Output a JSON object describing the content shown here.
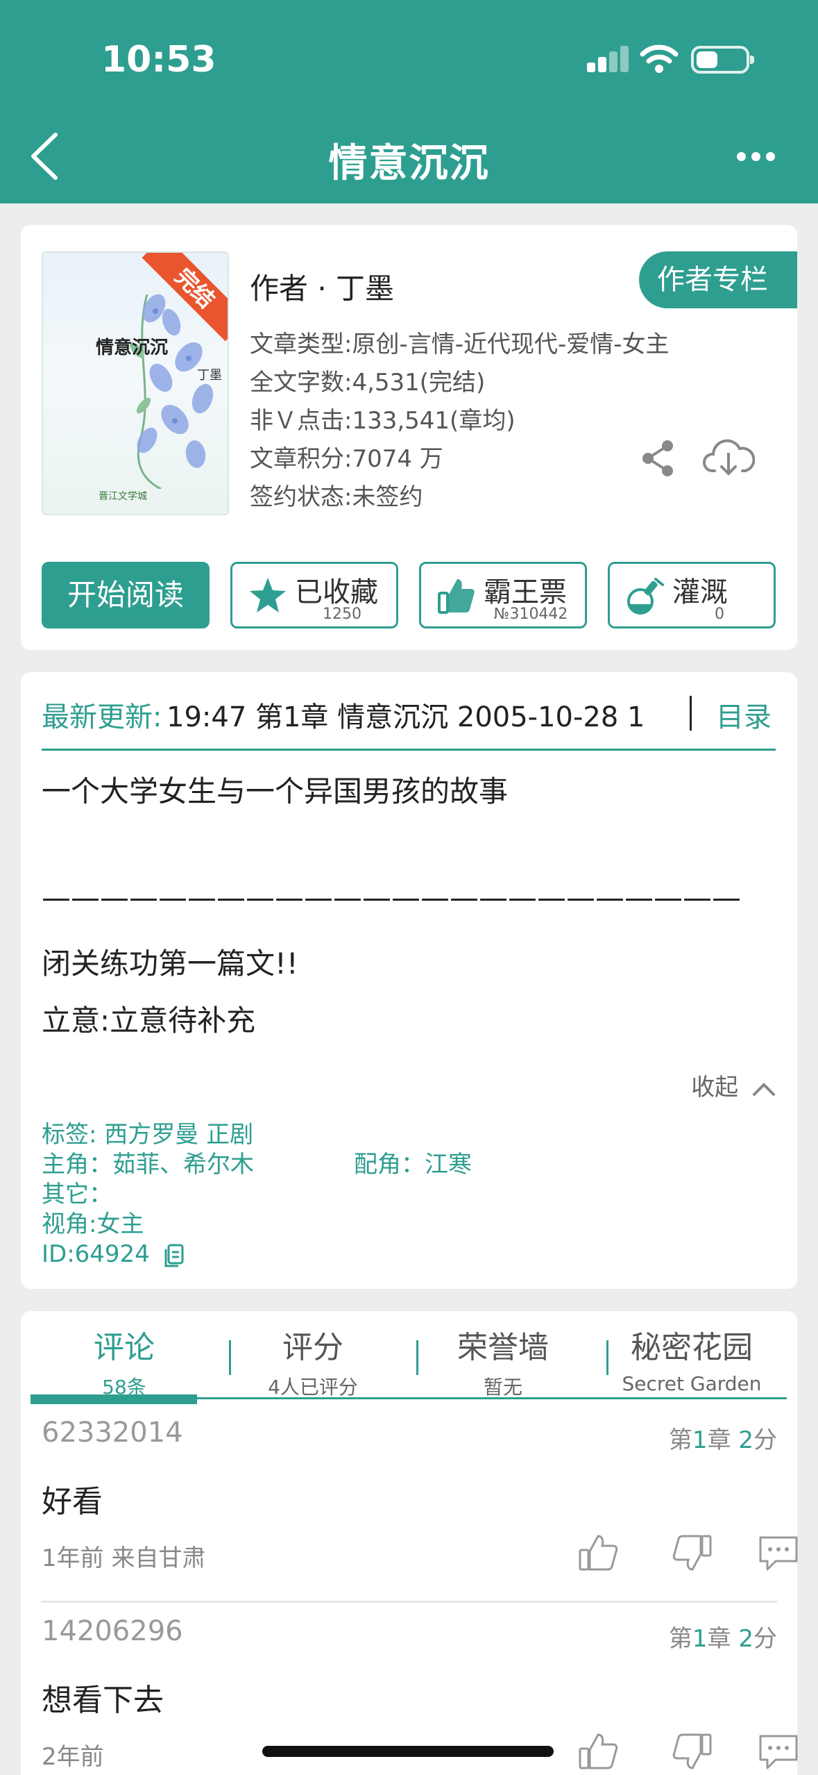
{
  "status_bar": {
    "time": "10:53"
  },
  "nav": {
    "title": "情意沉沉"
  },
  "book": {
    "cover_title": "情意沉沉",
    "cover_author": "丁墨",
    "cover_badge": "完结",
    "cover_logo": "晋江文学城",
    "author_line": "作者 · 丁墨",
    "author_column_label": "作者专栏",
    "meta": [
      "文章类型:原创-言情-近代现代-爱情-女主",
      "全文字数:4,531(完结)",
      "非Ｖ点击:133,541(章均)",
      "文章积分:7074 万",
      "签约状态:未签约"
    ]
  },
  "actions": {
    "start_label": "开始阅读",
    "favorite": {
      "label": "已收藏",
      "count": "1250"
    },
    "vote": {
      "label": "霸王票",
      "count": "№310442"
    },
    "water": {
      "label": "灌溉",
      "count": "0"
    }
  },
  "update": {
    "label": "最新更新:",
    "text": "19:47   第1章 情意沉沉 2005-10-28 1",
    "toc_label": "目录"
  },
  "intro": {
    "line1": "一个大学女生与一个异国男孩的故事",
    "line2": "————————————————————————",
    "line3": "闭关练功第一篇文!!",
    "line4": "立意:立意待补充",
    "collapse_label": "收起"
  },
  "tags": {
    "tags_line": "标签:   西方罗曼   正剧",
    "lead_line": "主角：茹菲、希尔木",
    "support_line": "配角：江寒",
    "other_line": "其它：",
    "pov_line": "视角:女主",
    "id_line": "ID:64924"
  },
  "tabs": [
    {
      "label": "评论",
      "sub": "58条"
    },
    {
      "label": "评分",
      "sub": "4人已评分"
    },
    {
      "label": "荣誉墙",
      "sub": "暂无"
    },
    {
      "label": "秘密花园",
      "sub": "Secret Garden"
    }
  ],
  "comments": [
    {
      "user": "62332014",
      "chap_prefix": "第",
      "chap_num": "1",
      "chap_mid": "章 ",
      "score": "2",
      "score_suffix": "分",
      "body": "好看",
      "meta": "1年前  来自甘肃"
    },
    {
      "user": "14206296",
      "chap_prefix": "第",
      "chap_num": "1",
      "chap_mid": "章 ",
      "score": "2",
      "score_suffix": "分",
      "body": "想看下去",
      "meta": "2年前"
    }
  ],
  "colors": {
    "accent": "#2e9e90",
    "badge": "#e8552f",
    "background": "#ededed"
  }
}
